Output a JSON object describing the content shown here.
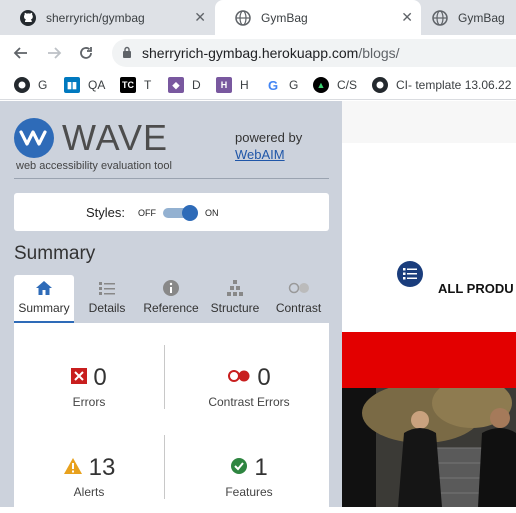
{
  "browser": {
    "tabs": [
      {
        "label": "sherryrich/gymbag",
        "icon": "github-icon",
        "active": false
      },
      {
        "label": "GymBag",
        "icon": "globe-icon",
        "active": true
      },
      {
        "label": "GymBag",
        "icon": "globe-icon",
        "active": false
      }
    ],
    "url_host": "sherryrich-gymbag.herokuapp.com",
    "url_path": "/blogs/",
    "bookmarks": [
      {
        "label": "G",
        "icon": "github-icon"
      },
      {
        "label": "QA",
        "icon": "trello-icon"
      },
      {
        "label": "T",
        "icon": "tc-icon"
      },
      {
        "label": "D",
        "icon": "heroku-d-icon"
      },
      {
        "label": "H",
        "icon": "heroku-h-icon"
      },
      {
        "label": "G",
        "icon": "google-icon"
      },
      {
        "label": "C/S",
        "icon": "codeinstitute-icon"
      },
      {
        "label": "CI- template 13.06.22",
        "icon": "github-icon"
      }
    ]
  },
  "wave": {
    "logo_text": "WAVE",
    "tagline": "web accessibility evaluation tool",
    "powered_by": "powered by",
    "powered_link": "WebAIM",
    "styles_label": "Styles:",
    "styles_off": "OFF",
    "styles_on": "ON",
    "styles_enabled": true,
    "summary_heading": "Summary",
    "tabs": [
      "Summary",
      "Details",
      "Reference",
      "Structure",
      "Contrast"
    ],
    "stats": {
      "errors": {
        "value": "0",
        "label": "Errors"
      },
      "contrast_errors": {
        "value": "0",
        "label": "Contrast Errors"
      },
      "alerts": {
        "value": "13",
        "label": "Alerts"
      },
      "features": {
        "value": "1",
        "label": "Features"
      }
    },
    "colors": {
      "accent": "#2e6bb8",
      "error": "#c81e1e",
      "alert": "#e8a11d",
      "feature": "#2e8540"
    }
  },
  "site": {
    "nav_label": "ALL PRODU",
    "band_color": "#e30000"
  }
}
